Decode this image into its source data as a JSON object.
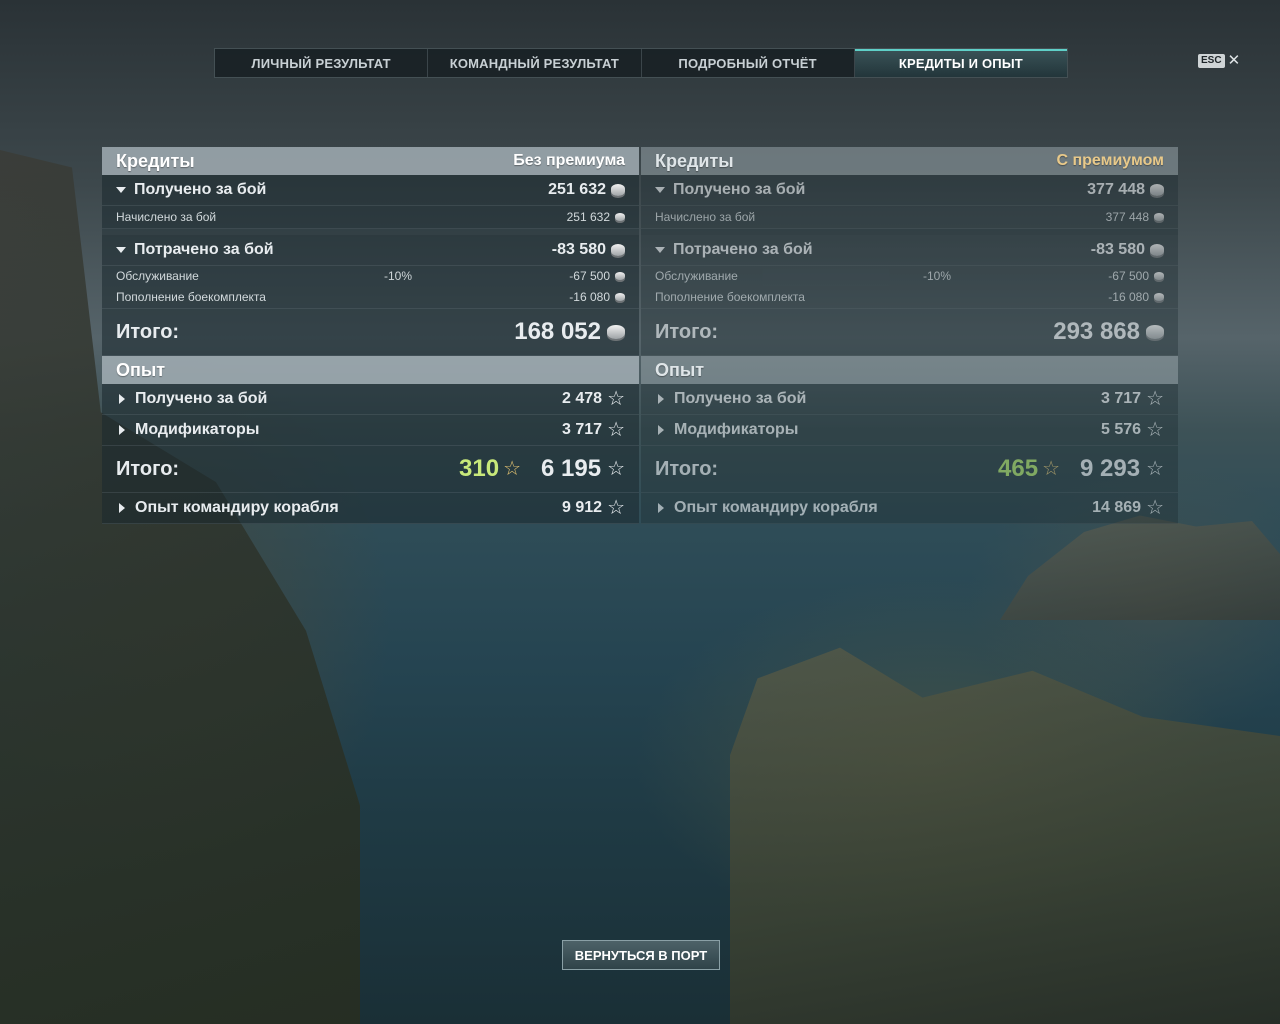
{
  "tabs": [
    {
      "label": "ЛИЧНЫЙ РЕЗУЛЬТАТ",
      "active": false
    },
    {
      "label": "КОМАНДНЫЙ РЕЗУЛЬТАТ",
      "active": false
    },
    {
      "label": "ПОДРОБНЫЙ ОТЧЁТ",
      "active": false
    },
    {
      "label": "КРЕДИТЫ И ОПЫТ",
      "active": true
    }
  ],
  "esc": {
    "key": "ESC",
    "close": "✕"
  },
  "left": {
    "credits": {
      "title": "Кредиты",
      "mode": "Без премиума",
      "earned_label": "Получено за бой",
      "earned_value": "251 632",
      "accrued_label": "Начислено за бой",
      "accrued_value": "251 632",
      "spent_label": "Потрачено за бой",
      "spent_value": "-83 580",
      "service_label": "Обслуживание",
      "service_pct": "-10%",
      "service_value": "-67 500",
      "ammo_label": "Пополнение боекомплекта",
      "ammo_value": "-16 080",
      "total_label": "Итого:",
      "total_value": "168 052"
    },
    "xp": {
      "title": "Опыт",
      "earned_label": "Получено за бой",
      "earned_value": "2 478",
      "mods_label": "Модификаторы",
      "mods_value": "3 717",
      "total_label": "Итого:",
      "free_value": "310",
      "total_value": "6 195",
      "commander_label": "Опыт командиру корабля",
      "commander_value": "9 912"
    }
  },
  "right": {
    "credits": {
      "title": "Кредиты",
      "mode": "С премиумом",
      "earned_label": "Получено за бой",
      "earned_value": "377 448",
      "accrued_label": "Начислено за бой",
      "accrued_value": "377 448",
      "spent_label": "Потрачено за бой",
      "spent_value": "-83 580",
      "service_label": "Обслуживание",
      "service_pct": "-10%",
      "service_value": "-67 500",
      "ammo_label": "Пополнение боекомплекта",
      "ammo_value": "-16 080",
      "total_label": "Итого:",
      "total_value": "293 868"
    },
    "xp": {
      "title": "Опыт",
      "earned_label": "Получено за бой",
      "earned_value": "3 717",
      "mods_label": "Модификаторы",
      "mods_value": "5 576",
      "total_label": "Итого:",
      "free_value": "465",
      "total_value": "9 293",
      "commander_label": "Опыт командиру корабля",
      "commander_value": "14 869"
    }
  },
  "return_button": "ВЕРНУТЬСЯ В ПОРТ",
  "colors": {
    "active_tab_accent": "#5fd0c8",
    "premium_gold": "#e8c98a",
    "free_xp_green": "#c8e87a"
  },
  "icons": {
    "credit": "coin-icon",
    "xp": "star-icon",
    "expand": "triangle-down-icon",
    "collapsed": "triangle-right-icon"
  }
}
